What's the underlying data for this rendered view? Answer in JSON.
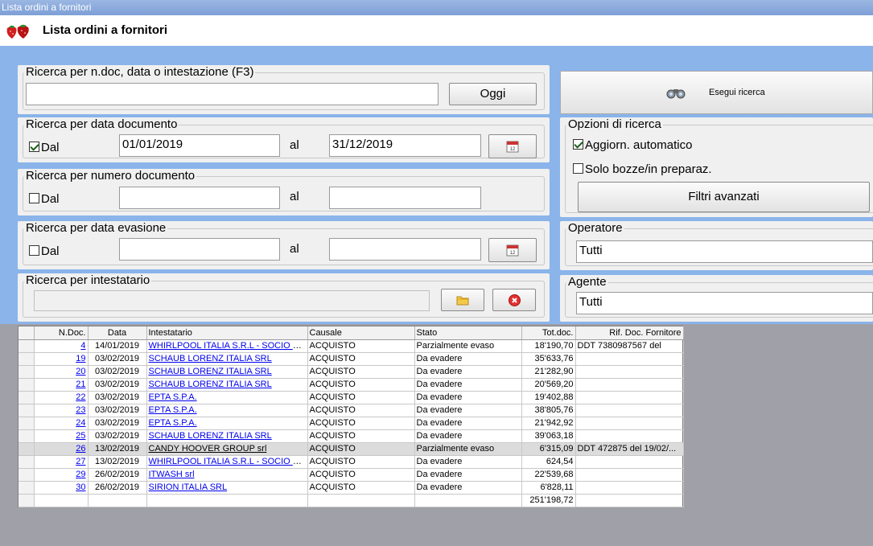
{
  "window": {
    "title": "Lista ordini a fornitori"
  },
  "header": {
    "title": "Lista ordini a fornitori",
    "logo_icon": "strawberry-icon"
  },
  "search_general": {
    "label": "Ricerca per n.doc, data o intestazione (F3)",
    "value": "",
    "today_button": "Oggi"
  },
  "search_doc_date": {
    "label": "Ricerca per data documento",
    "checkbox_label": "Dal",
    "checked": true,
    "from": "01/01/2019",
    "to_label": "al",
    "to": "31/12/2019"
  },
  "search_doc_number": {
    "label": "Ricerca per numero documento",
    "checkbox_label": "Dal",
    "checked": false,
    "from": "",
    "to_label": "al",
    "to": ""
  },
  "search_evasion_date": {
    "label": "Ricerca per data evasione",
    "checkbox_label": "Dal",
    "checked": false,
    "from": "",
    "to_label": "al",
    "to": ""
  },
  "search_holder": {
    "label": "Ricerca per intestatario",
    "value": ""
  },
  "run_search": {
    "label": "Esegui ricerca"
  },
  "options": {
    "label": "Opzioni di ricerca",
    "auto_update": "Aggiorn. automatico",
    "auto_update_checked": true,
    "drafts_only": "Solo bozze/in preparaz.",
    "drafts_only_checked": false,
    "advanced_filters": "Filtri avanzati"
  },
  "operator": {
    "label": "Operatore",
    "value": "Tutti"
  },
  "agent": {
    "label": "Agente",
    "value": "Tutti"
  },
  "table": {
    "columns": [
      "N.Doc.",
      "Data",
      "Intestatario",
      "Causale",
      "Stato",
      "Tot.doc.",
      "Rif. Doc. Fornitore"
    ],
    "rows": [
      {
        "ndoc": "4",
        "data": "14/01/2019",
        "intestatario": "WHIRLPOOL ITALIA S.R.L - SOCIO U...",
        "causale": "ACQUISTO",
        "stato": "Parzialmente evaso",
        "tot": "18'190,70",
        "rif": "DDT 7380987567 del"
      },
      {
        "ndoc": "19",
        "data": "03/02/2019",
        "intestatario": "SCHAUB LORENZ ITALIA SRL",
        "causale": "ACQUISTO",
        "stato": "Da evadere",
        "tot": "35'633,76",
        "rif": ""
      },
      {
        "ndoc": "20",
        "data": "03/02/2019",
        "intestatario": "SCHAUB LORENZ ITALIA SRL",
        "causale": "ACQUISTO",
        "stato": "Da evadere",
        "tot": "21'282,90",
        "rif": ""
      },
      {
        "ndoc": "21",
        "data": "03/02/2019",
        "intestatario": "SCHAUB LORENZ ITALIA SRL",
        "causale": "ACQUISTO",
        "stato": "Da evadere",
        "tot": "20'569,20",
        "rif": ""
      },
      {
        "ndoc": "22",
        "data": "03/02/2019",
        "intestatario": "EPTA S.P.A.",
        "causale": "ACQUISTO",
        "stato": "Da evadere",
        "tot": "19'402,88",
        "rif": ""
      },
      {
        "ndoc": "23",
        "data": "03/02/2019",
        "intestatario": "EPTA S.P.A.",
        "causale": "ACQUISTO",
        "stato": "Da evadere",
        "tot": "38'805,76",
        "rif": ""
      },
      {
        "ndoc": "24",
        "data": "03/02/2019",
        "intestatario": "EPTA S.P.A.",
        "causale": "ACQUISTO",
        "stato": "Da evadere",
        "tot": "21'942,92",
        "rif": ""
      },
      {
        "ndoc": "25",
        "data": "03/02/2019",
        "intestatario": "SCHAUB LORENZ ITALIA SRL",
        "causale": "ACQUISTO",
        "stato": "Da evadere",
        "tot": "39'063,18",
        "rif": ""
      },
      {
        "ndoc": "26",
        "data": "13/02/2019",
        "intestatario": "CANDY HOOVER GROUP srl",
        "causale": "ACQUISTO",
        "stato": "Parzialmente evaso",
        "tot": "6'315,09",
        "rif": "DDT 472875 del 19/02/...",
        "selected": true
      },
      {
        "ndoc": "27",
        "data": "13/02/2019",
        "intestatario": "WHIRLPOOL ITALIA S.R.L - SOCIO U...",
        "causale": "ACQUISTO",
        "stato": "Da evadere",
        "tot": "624,54",
        "rif": ""
      },
      {
        "ndoc": "29",
        "data": "26/02/2019",
        "intestatario": "ITWASH srl",
        "causale": "ACQUISTO",
        "stato": "Da evadere",
        "tot": "22'539,68",
        "rif": ""
      },
      {
        "ndoc": "30",
        "data": "26/02/2019",
        "intestatario": "SIRION ITALIA SRL",
        "causale": "ACQUISTO",
        "stato": "Da evadere",
        "tot": "6'828,11",
        "rif": ""
      }
    ],
    "total": "251'198,72"
  }
}
